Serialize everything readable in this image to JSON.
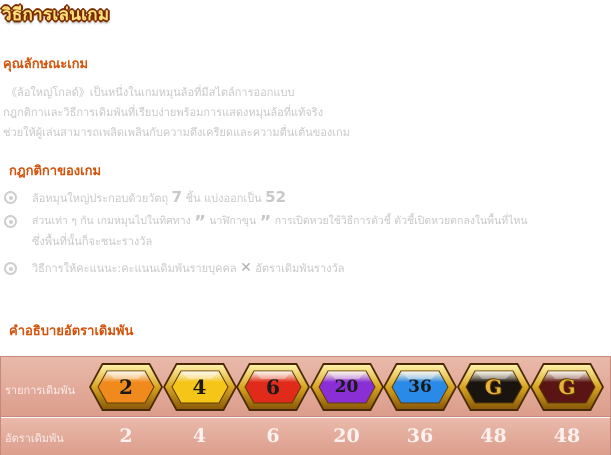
{
  "page_title": "วิธีการเล่นเกม",
  "features": {
    "heading": "คุณลักษณะเกม",
    "lines": [
      "《ล้อใหญ่โกลด์》เป็นหนึ่งในเกมหมุนล้อที่มีสไตล์การออกแบบ",
      "กฎกติกาและวิธีการเดิมพันที่เรียบง่ายพร้อมการแสดงหมุนล้อที่แท้จริง",
      "ช่วยให้ผู้เล่นสามารถเพลิดเพลินกับความตึงเครียดและความตื่นเต้นของเกม"
    ]
  },
  "rules": {
    "heading": "กฎกติกาของเกม",
    "bullet1": {
      "text_a": "ล้อหมุนใหญ่ประกอบด้วยวัตถุ",
      "num_a": "7",
      "text_b": "ชิ้น แบ่งออกเป็น",
      "num_b": "52"
    },
    "bullet2": {
      "text_a": "ส่วนเท่า ๆ กัน เกมหมุนไปในทิศทาง",
      "quote_open": "”",
      "text_b": "นาฬิกาขุน",
      "quote_close": "”",
      "text_c": "การเปิดหวยใช้วิธีการตัวชี้ ตัวชี้เปิดหวยตกลงในพื้นที่ไหน",
      "line2": "ซึ่งพื้นที่นั้นก็จะชนะรางวัล"
    },
    "bullet3": {
      "text_a": "วิธีการให้คะแนนะ:คะแนนเดิมพันรายบุคคล",
      "times": "✕",
      "text_b": "อัตราเดิมพันรางวัล"
    }
  },
  "bet_section": {
    "heading": "คำอธิบายอัตราเดิมพัน",
    "row1_label": "รายการเดิมพัน",
    "row2_label": "อัตราเดิมพัน",
    "items": [
      {
        "symbol": "2",
        "payout": "2",
        "color": "#f08a1c"
      },
      {
        "symbol": "4",
        "payout": "4",
        "color": "#f5c518"
      },
      {
        "symbol": "6",
        "payout": "6",
        "color": "#e02a1a"
      },
      {
        "symbol": "20",
        "payout": "20",
        "color": "#8a2ed6"
      },
      {
        "symbol": "36",
        "payout": "36",
        "color": "#2a8ae8"
      },
      {
        "symbol": "G",
        "payout": "48",
        "color": "#1a1410"
      },
      {
        "symbol": "G",
        "payout": "48",
        "color": "#5a1414"
      }
    ]
  },
  "colors": {
    "title_fill": "#ffe07a",
    "heading": "#d4520a",
    "body_text": "#c8c8c8",
    "table_bg": "#e2a895",
    "gem_frame": "#d9a520"
  }
}
